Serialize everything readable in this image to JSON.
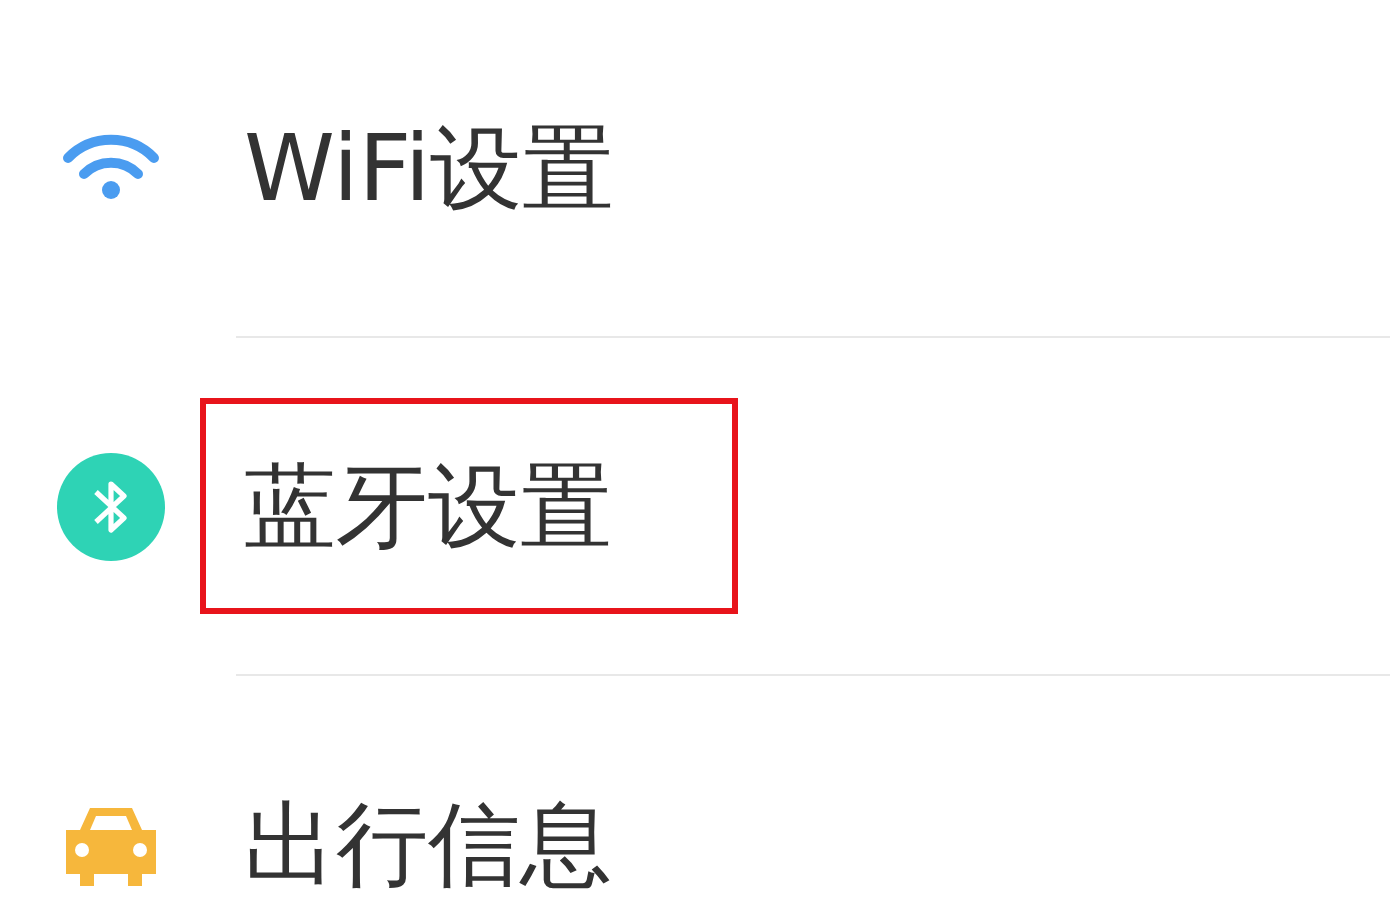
{
  "settings_list": [
    {
      "kind": "wifi",
      "label": "WiFi设置",
      "highlighted": false
    },
    {
      "kind": "bluetooth",
      "label": "蓝牙设置",
      "highlighted": true
    },
    {
      "kind": "car",
      "label": "出行信息",
      "highlighted": false
    }
  ]
}
